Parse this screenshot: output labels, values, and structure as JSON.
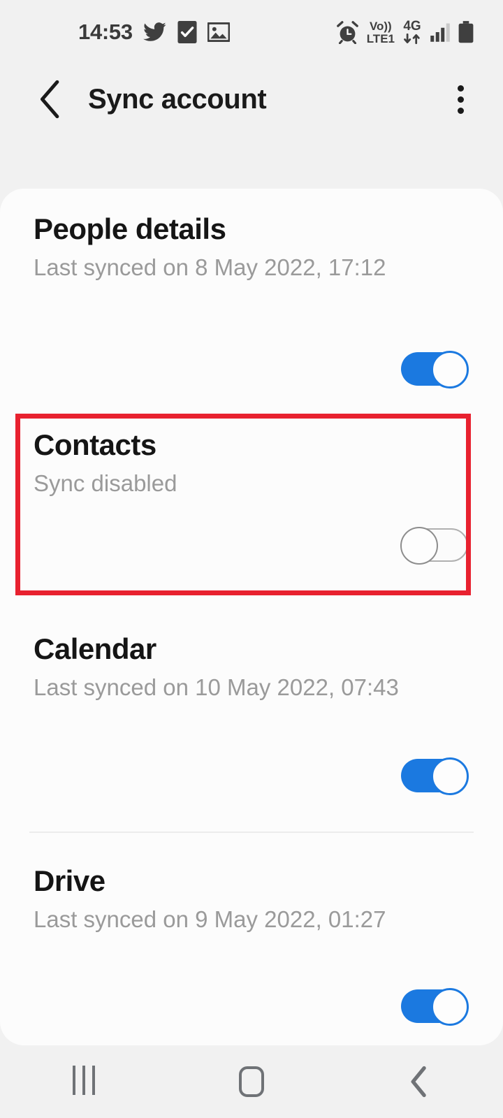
{
  "status_bar": {
    "time": "14:53",
    "left_icons": [
      "twitter-icon",
      "tasks-checkbox-icon",
      "gallery-image-icon"
    ],
    "network_label_top": "Vo))",
    "network_label_bottom": "LTE1",
    "data_label": "4G",
    "right_icons": [
      "alarm-icon",
      "volte-icon",
      "data-arrows-icon",
      "signal-bars-icon",
      "battery-icon"
    ]
  },
  "app_bar": {
    "title": "Sync account",
    "back_icon": "chevron-left-icon",
    "overflow_icon": "more-vertical-icon"
  },
  "sync_items": [
    {
      "title": "People details",
      "subtitle": "Last synced on 8 May 2022, 17:12",
      "toggle_state": "on"
    },
    {
      "title": "Contacts",
      "subtitle": "Sync disabled",
      "toggle_state": "off"
    },
    {
      "title": "Calendar",
      "subtitle": "Last synced on 10 May 2022, 07:43",
      "toggle_state": "on"
    },
    {
      "title": "Drive",
      "subtitle": "Last synced on 9 May 2022, 01:27",
      "toggle_state": "on"
    }
  ],
  "highlight": {
    "target": "Contacts",
    "color": "#e8212f"
  },
  "nav_bar": {
    "recents_icon": "recents-icon",
    "home_icon": "home-icon",
    "back_icon": "back-chevron-icon"
  },
  "colors": {
    "toggle_on": "#1b79e0",
    "background": "#f1f1f1",
    "card": "#fcfcfc",
    "title_text": "#151515",
    "subtitle_text": "#9a9a9a"
  }
}
